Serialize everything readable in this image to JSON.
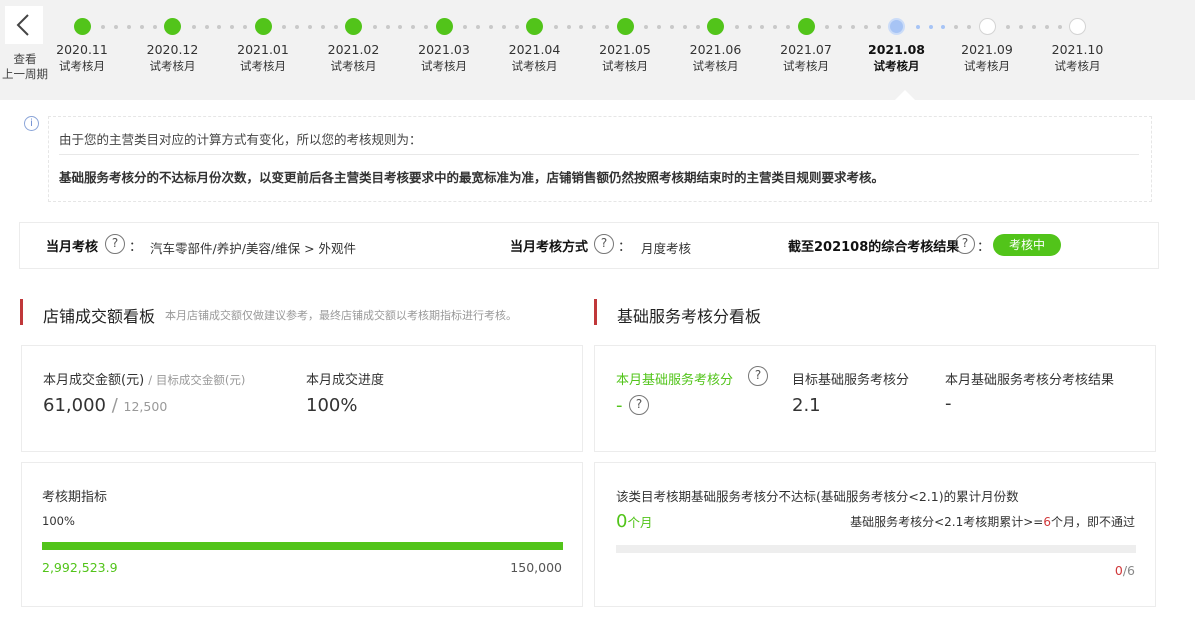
{
  "nav": {
    "back_label": "查看\n上一周期"
  },
  "timeline": [
    {
      "month": "2020.11",
      "status": "试考核月",
      "state": "done"
    },
    {
      "month": "2020.12",
      "status": "试考核月",
      "state": "done"
    },
    {
      "month": "2021.01",
      "status": "试考核月",
      "state": "done"
    },
    {
      "month": "2021.02",
      "status": "试考核月",
      "state": "done"
    },
    {
      "month": "2021.03",
      "status": "试考核月",
      "state": "done"
    },
    {
      "month": "2021.04",
      "status": "试考核月",
      "state": "done"
    },
    {
      "month": "2021.05",
      "status": "试考核月",
      "state": "done"
    },
    {
      "month": "2021.06",
      "status": "试考核月",
      "state": "done"
    },
    {
      "month": "2021.07",
      "status": "试考核月",
      "state": "done"
    },
    {
      "month": "2021.08",
      "status": "试考核月",
      "state": "current"
    },
    {
      "month": "2021.09",
      "status": "试考核月",
      "state": "future"
    },
    {
      "month": "2021.10",
      "status": "试考核月",
      "state": "future"
    }
  ],
  "notice": {
    "line1": "由于您的主营类目对应的计算方式有变化，所以您的考核规则为：",
    "line2": "基础服务考核分的不达标月份次数，以变更前后各主营类目考核要求中的最宽标准为准，店铺销售额仍然按照考核期结束时的主营类目规则要求考核。"
  },
  "assessment": {
    "month_label": "当月考核",
    "month_value": "汽车零部件/养护/美容/维保 > 外观件",
    "method_label": "当月考核方式",
    "method_value": "月度考核",
    "result_label": "截至202108的综合考核结果",
    "result_status": "考核中",
    "colon": "："
  },
  "sales_board": {
    "title": "店铺成交额看板",
    "subtitle": "本月店铺成交额仅做建议参考，最终店铺成交额以考核期指标进行考核。",
    "amount_label": "本月成交金额(元)",
    "target_label": "/ 目标成交金额(元)",
    "amount_value": "61,000",
    "target_value": "12,500",
    "slash": "/",
    "progress_label": "本月成交进度",
    "progress_value": "100%",
    "period_label": "考核期指标",
    "period_percent_text": "100%",
    "period_percent": 1.0,
    "period_current": "2,992,523.9",
    "period_target": "150,000"
  },
  "service_board": {
    "title": "基础服务考核分看板",
    "score_label": "本月基础服务考核分",
    "score_value": "-",
    "target_label": "目标基础服务考核分",
    "target_value": "2.1",
    "result_label": "本月基础服务考核分考核结果",
    "result_value": "-",
    "fail_title": "该类目考核期基础服务考核分不达标(基础服务考核分<2.1)的累计月份数",
    "fail_count": "0",
    "fail_unit": "个月",
    "rule_prefix": "基础服务考核分<2.1考核期累计>=",
    "rule_count": "6",
    "rule_suffix": "个月，即不通过",
    "ratio_current": "0",
    "ratio_total": "/6",
    "fail_fraction": 0.0
  },
  "colors": {
    "green": "#52c41a",
    "red": "#c0383a",
    "current_dot": "#a7c4f5"
  }
}
